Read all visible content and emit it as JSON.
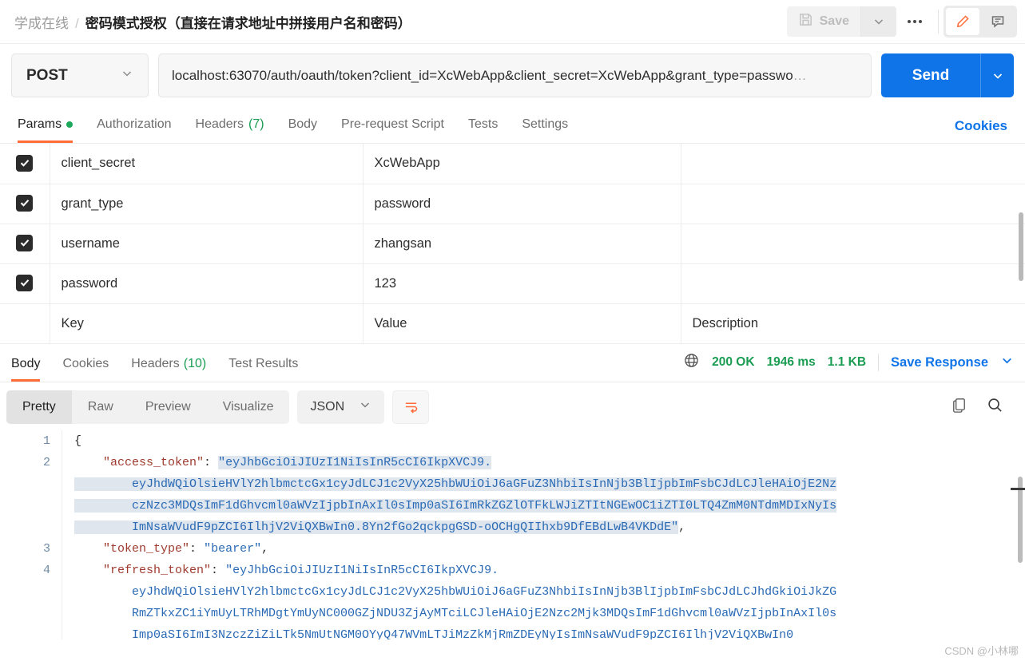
{
  "breadcrumb": {
    "collection": "学成在线",
    "separator": "/",
    "request_title": "密码模式授权（直接在请求地址中拼接用户名和密码）"
  },
  "toolbar": {
    "save_label": "Save",
    "save_icon": "floppy-disk-icon",
    "save_caret_icon": "chevron-down-icon",
    "more_icon": "ellipsis-icon",
    "edit_icon": "pencil-icon",
    "comment_icon": "comment-icon",
    "accent_orange": "#ff6c37"
  },
  "request": {
    "method": "POST",
    "method_caret_icon": "chevron-down-icon",
    "url": "localhost:63070/auth/oauth/token?client_id=XcWebApp&client_secret=XcWebApp&grant_type=passwo",
    "url_ellipsis": "…",
    "send_label": "Send",
    "send_caret_icon": "chevron-down-icon",
    "send_color": "#0f74e8"
  },
  "request_tabs": [
    {
      "label": "Params",
      "badge": "",
      "active": true,
      "dot": true
    },
    {
      "label": "Authorization",
      "badge": "",
      "active": false,
      "dot": false
    },
    {
      "label": "Headers",
      "badge": "(7)",
      "active": false,
      "dot": false
    },
    {
      "label": "Body",
      "badge": "",
      "active": false,
      "dot": false
    },
    {
      "label": "Pre-request Script",
      "badge": "",
      "active": false,
      "dot": false
    },
    {
      "label": "Tests",
      "badge": "",
      "active": false,
      "dot": false
    },
    {
      "label": "Settings",
      "badge": "",
      "active": false,
      "dot": false
    }
  ],
  "cookies_link": "Cookies",
  "params_table": {
    "columns": [
      "Key",
      "Value",
      "Description"
    ],
    "rows": [
      {
        "checked": true,
        "key": "client_secret",
        "value": "XcWebApp",
        "description": ""
      },
      {
        "checked": true,
        "key": "grant_type",
        "value": "password",
        "description": ""
      },
      {
        "checked": true,
        "key": "username",
        "value": "zhangsan",
        "description": ""
      },
      {
        "checked": true,
        "key": "password",
        "value": "123",
        "description": ""
      }
    ],
    "empty_row": {
      "key": "Key",
      "value": "Value",
      "description": "Description"
    }
  },
  "response_tabs": [
    {
      "label": "Body",
      "badge": "",
      "active": true
    },
    {
      "label": "Cookies",
      "badge": "",
      "active": false
    },
    {
      "label": "Headers",
      "badge": "(10)",
      "active": false
    },
    {
      "label": "Test Results",
      "badge": "",
      "active": false
    }
  ],
  "response_meta": {
    "globe_icon": "globe-icon",
    "status": "200 OK",
    "time": "1946 ms",
    "size": "1.1 KB",
    "save_response": "Save Response",
    "save_response_caret_icon": "chevron-down-icon",
    "green": "#1a9c53"
  },
  "format_bar": {
    "modes": [
      "Pretty",
      "Raw",
      "Preview",
      "Visualize"
    ],
    "active_mode": "Pretty",
    "language": "JSON",
    "language_caret_icon": "chevron-down-icon",
    "wrap_icon": "wrap-lines-icon",
    "copy_icon": "copy-icon",
    "search_icon": "search-icon"
  },
  "response_body": {
    "language": "json",
    "line_numbers": [
      "1",
      "2",
      "3",
      "4"
    ],
    "lines": [
      {
        "num": "1",
        "segments": [
          {
            "t": "{",
            "c": "p"
          }
        ]
      },
      {
        "num": "2",
        "segments": [
          {
            "t": "    ",
            "c": "p"
          },
          {
            "t": "\"access_token\"",
            "c": "k"
          },
          {
            "t": ": ",
            "c": "p"
          },
          {
            "t": "\"eyJhbGciOiJIUzI1NiIsInR5cCI6IkpXVCJ9.",
            "c": "s sel"
          }
        ]
      },
      {
        "num": "",
        "segments": [
          {
            "t": "        eyJhdWQiOlsieHVlY2hlbmctcGx1cyJdLCJ1c2VyX25hbWUiOiJ6aGFuZ3NhbiIsInNjb3BlIjpbImFsbCJdLCJleHAiOjE2Nz",
            "c": "s sel"
          }
        ]
      },
      {
        "num": "",
        "segments": [
          {
            "t": "        czNzc3MDQsImF1dGhvcml0aWVzIjpbInAxIl0sImp0aSI6ImRkZGZlOTFkLWJiZTItNGEwOC1iZTI0LTQ4ZmM0NTdmMDIxNyIs",
            "c": "s sel"
          }
        ]
      },
      {
        "num": "",
        "segments": [
          {
            "t": "        ImNsaWVudF9pZCI6IlhjV2ViQXBwIn0.8Yn2fGo2qckpgGSD-oOCHgQIIhxb9DfEBdLwB4VKDdE\"",
            "c": "s sel"
          },
          {
            "t": ",",
            "c": "p"
          }
        ]
      },
      {
        "num": "3",
        "segments": [
          {
            "t": "    ",
            "c": "p"
          },
          {
            "t": "\"token_type\"",
            "c": "k"
          },
          {
            "t": ": ",
            "c": "p"
          },
          {
            "t": "\"bearer\"",
            "c": "s"
          },
          {
            "t": ",",
            "c": "p"
          }
        ]
      },
      {
        "num": "4",
        "segments": [
          {
            "t": "    ",
            "c": "p"
          },
          {
            "t": "\"refresh_token\"",
            "c": "k"
          },
          {
            "t": ": ",
            "c": "p"
          },
          {
            "t": "\"eyJhbGciOiJIUzI1NiIsInR5cCI6IkpXVCJ9.",
            "c": "s"
          }
        ]
      },
      {
        "num": "",
        "segments": [
          {
            "t": "        eyJhdWQiOlsieHVlY2hlbmctcGx1cyJdLCJ1c2VyX25hbWUiOiJ6aGFuZ3NhbiIsInNjb3BlIjpbImFsbCJdLCJhdGkiOiJkZG",
            "c": "s"
          }
        ]
      },
      {
        "num": "",
        "segments": [
          {
            "t": "        RmZTkxZC1iYmUyLTRhMDgtYmUyNC000GZjNDU3ZjAyMTciLCJleHAiOjE2Nzc2Mjk3MDQsImF1dGhvcml0aWVzIjpbInAxIl0s",
            "c": "s"
          }
        ]
      },
      {
        "num": "",
        "segments": [
          {
            "t": "        Imp0aSI6ImI3NzczZiZiLTk5NmUtNGM0OYyQ47WVmLTJiMzZkMjRmZDEyNyIsImNsaWVudF9pZCI6IlhjV2ViQXBwIn0",
            "c": "s"
          }
        ]
      }
    ]
  },
  "watermark": "CSDN @小林哪"
}
